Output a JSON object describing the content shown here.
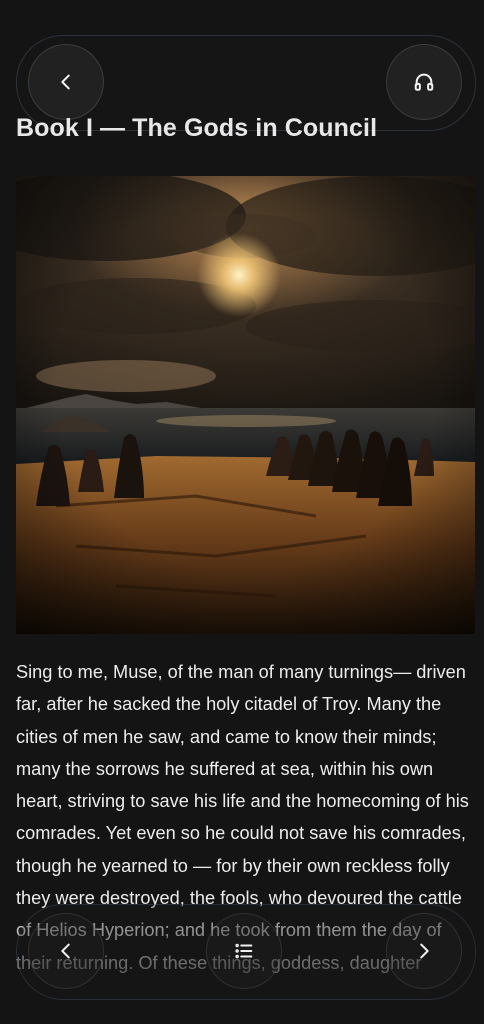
{
  "header": {
    "back_icon": "chevron-left-icon",
    "listen_icon": "headphones-icon"
  },
  "chapter": {
    "title": "Book I — The Gods in Council",
    "image_alt": "Robed figures standing on a cliff beside the sea under a dark, glowing sky"
  },
  "text": {
    "body": "Sing to me, Muse, of the man of many turnings— driven far, after he sacked the holy citadel of Troy. Many the cities of men he saw, and came to know their minds; many the sorrows he suffered at sea, within his own heart, striving to save his life and the homecoming of his comrades. Yet even so he could not save his comrades, though he yearned to — for by their own reckless folly they were destroyed, the fools, who devoured the cattle of Helios Hyperion; and he took from them the day of their returning. Of these things, goddess, daughter"
  },
  "footer": {
    "prev_icon": "chevron-left-icon",
    "contents_icon": "list-icon",
    "next_icon": "chevron-right-icon"
  }
}
